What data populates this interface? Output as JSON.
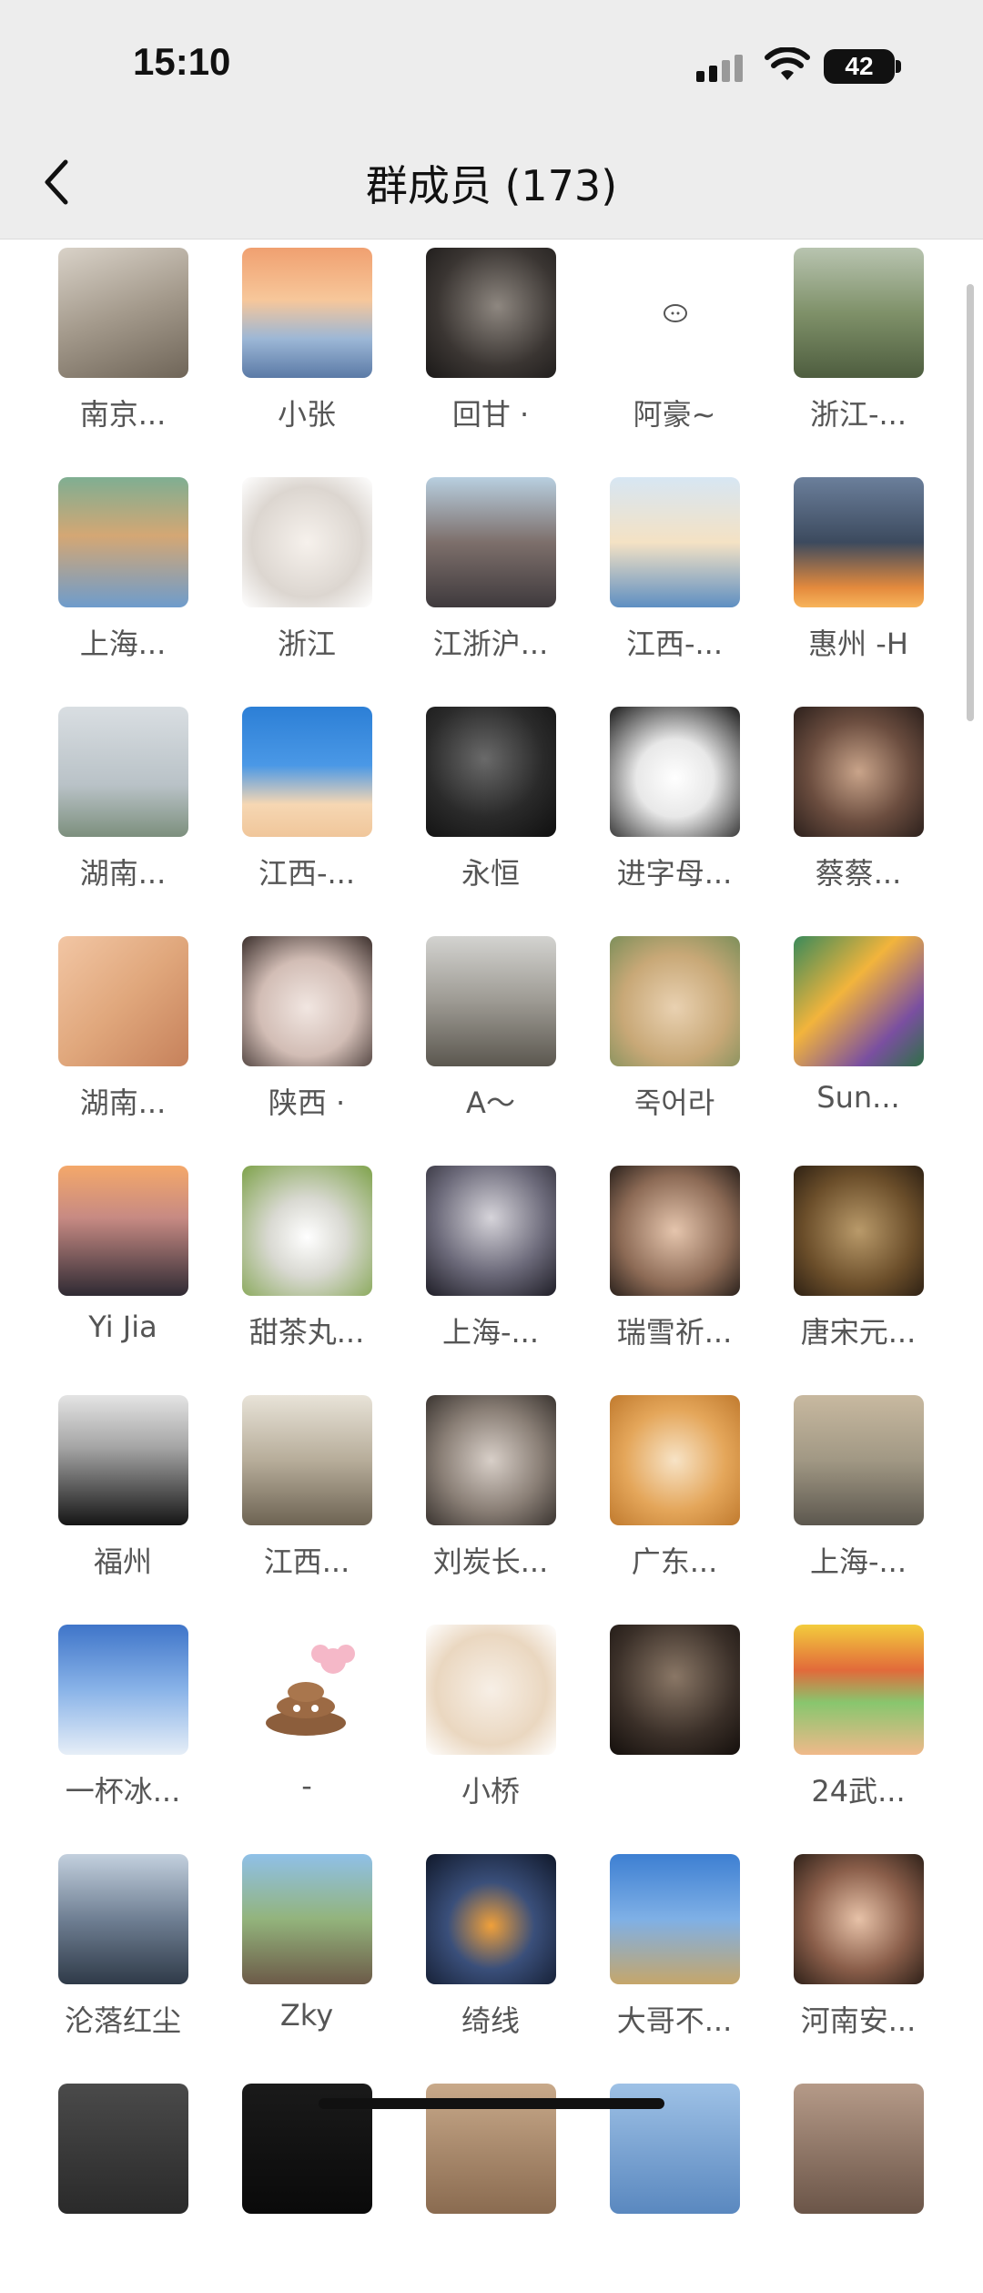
{
  "status": {
    "time": "15:10",
    "battery": "42"
  },
  "header": {
    "title": "群成员 (173)"
  },
  "members": [
    {
      "name": "南京...",
      "avatar": "person-photo"
    },
    {
      "name": "小张",
      "avatar": "anime-boy-sunset"
    },
    {
      "name": "回甘 ·",
      "avatar": "silhouette-dark"
    },
    {
      "name": "阿豪~",
      "avatar": "small-pig-sketch"
    },
    {
      "name": "浙江-...",
      "avatar": "landscape-person"
    },
    {
      "name": "上海...",
      "avatar": "shiba-costume"
    },
    {
      "name": "浙江",
      "avatar": "cartoon-girl-glasses"
    },
    {
      "name": "江浙沪...",
      "avatar": "city-street"
    },
    {
      "name": "江西-...",
      "avatar": "anime-girl-beach"
    },
    {
      "name": "惠州 -H",
      "avatar": "sunset-clouds"
    },
    {
      "name": "湖南...",
      "avatar": "misty-bridge"
    },
    {
      "name": "江西-...",
      "avatar": "crayon-shinchan"
    },
    {
      "name": "永恒",
      "avatar": "dark-portrait"
    },
    {
      "name": "进字母...",
      "avatar": "manga-boy"
    },
    {
      "name": "蔡蔡...",
      "avatar": "girl-portrait"
    },
    {
      "name": "湖南...",
      "avatar": "painting-girl"
    },
    {
      "name": "陕西 ·",
      "avatar": "girl-cover-face"
    },
    {
      "name": "A～",
      "avatar": "person-with-dog"
    },
    {
      "name": "죽어라",
      "avatar": "cat-in-hat"
    },
    {
      "name": "Sun...",
      "avatar": "hedgehog-illustration"
    },
    {
      "name": "Yi Jia",
      "avatar": "girl-riverside"
    },
    {
      "name": "甜茶丸...",
      "avatar": "frog-hat-dog"
    },
    {
      "name": "上海-...",
      "avatar": "white-hair-boy"
    },
    {
      "name": "瑞雪祈...",
      "avatar": "smiling-boy"
    },
    {
      "name": "唐宋元...",
      "avatar": "sunglasses-woman"
    },
    {
      "name": "福州",
      "avatar": "man-black-suit"
    },
    {
      "name": "江西...",
      "avatar": "woman-window"
    },
    {
      "name": "刘炭长...",
      "avatar": "couple-photo"
    },
    {
      "name": "广东...",
      "avatar": "smiling-shiba"
    },
    {
      "name": "上海-...",
      "avatar": "beach-sunset"
    },
    {
      "name": "一杯冰...",
      "avatar": "man-snow-jacket"
    },
    {
      "name": "-",
      "avatar": "poop-flower"
    },
    {
      "name": "小桥",
      "avatar": "anime-boy-cat"
    },
    {
      "name": "",
      "avatar": "dark-room-girl"
    },
    {
      "name": "24武...",
      "avatar": "cartoon-fat-guy"
    },
    {
      "name": "沦落红尘",
      "avatar": "snow-mountains"
    },
    {
      "name": "Zky",
      "avatar": "couple-park"
    },
    {
      "name": "绮线",
      "avatar": "alien-fire"
    },
    {
      "name": "大哥不...",
      "avatar": "man-blue-sky"
    },
    {
      "name": "河南安...",
      "avatar": "kids-eating"
    },
    {
      "name": "",
      "avatar": "partial-dark"
    },
    {
      "name": "",
      "avatar": "partial-black"
    },
    {
      "name": "",
      "avatar": "partial-warm"
    },
    {
      "name": "",
      "avatar": "partial-blue"
    },
    {
      "name": "",
      "avatar": "partial-portrait"
    }
  ],
  "colors": {
    "bar_bg": "#ededed",
    "text": "#111111",
    "name_text": "#555555"
  }
}
